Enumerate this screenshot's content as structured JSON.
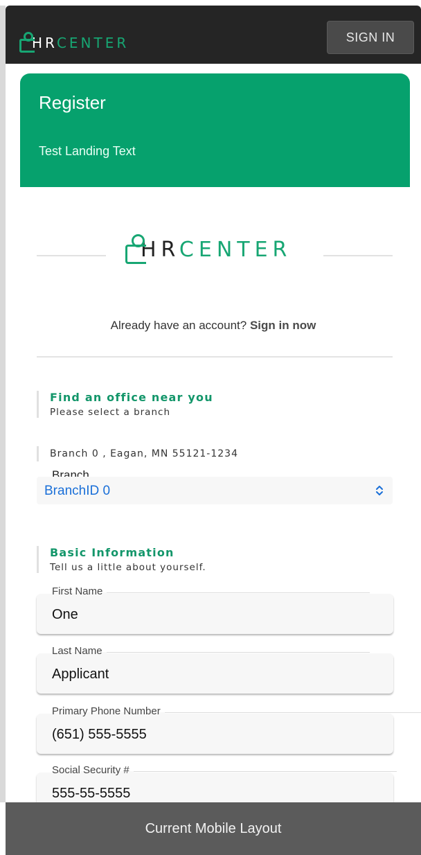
{
  "header": {
    "logo_hr": "HR",
    "logo_center": "CENTER",
    "signin_label": "SIGN IN"
  },
  "register_card": {
    "title": "Register",
    "text": "Test Landing Text"
  },
  "brand": {
    "hr": "HR",
    "center": "CENTER"
  },
  "account": {
    "prompt": "Already have an account?",
    "link": "Sign in now"
  },
  "office_section": {
    "title": "Find an office near you",
    "subtitle": "Please select a branch",
    "address": "Branch 0 , Eagan, MN 55121-1234",
    "branch_label": "Branch",
    "branch_value": "BranchID 0"
  },
  "basic_section": {
    "title": "Basic Information",
    "subtitle": "Tell us a little about yourself."
  },
  "fields": [
    {
      "label": "First Name",
      "value": "One"
    },
    {
      "label": "Last Name",
      "value": "Applicant"
    },
    {
      "label": "Primary Phone Number",
      "value": "(651) 555-5555"
    },
    {
      "label": "Social Security #",
      "value": "555-55-5555"
    }
  ],
  "banner": {
    "text": "Current Mobile Layout"
  },
  "colors": {
    "brand_green": "#06a16d",
    "header_dark": "#252525",
    "link_blue": "#1a6fd8"
  }
}
